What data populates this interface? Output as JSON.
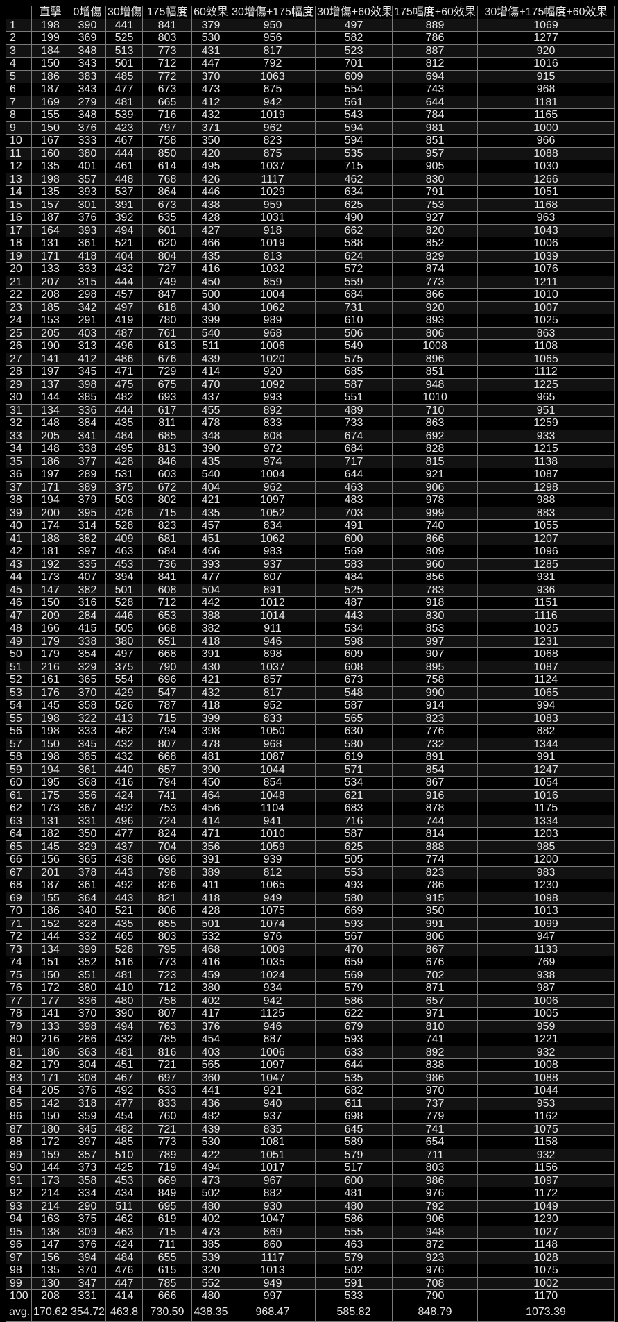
{
  "table": {
    "headers": [
      "",
      "直擊",
      "0增傷",
      "30增傷",
      "175幅度",
      "60效果",
      "30增傷+175幅度",
      "30增傷+60效果",
      "175幅度+60效果",
      "30增傷+175幅度+60效果"
    ],
    "rows": [
      [
        "1",
        "198",
        "390",
        "441",
        "841",
        "379",
        "950",
        "497",
        "889",
        "1069"
      ],
      [
        "2",
        "199",
        "369",
        "525",
        "803",
        "530",
        "956",
        "582",
        "786",
        "1277"
      ],
      [
        "3",
        "184",
        "348",
        "513",
        "773",
        "431",
        "817",
        "523",
        "887",
        "920"
      ],
      [
        "4",
        "150",
        "343",
        "501",
        "712",
        "447",
        "792",
        "701",
        "812",
        "1016"
      ],
      [
        "5",
        "186",
        "383",
        "485",
        "772",
        "370",
        "1063",
        "609",
        "694",
        "915"
      ],
      [
        "6",
        "187",
        "343",
        "477",
        "673",
        "473",
        "875",
        "554",
        "743",
        "968"
      ],
      [
        "7",
        "169",
        "279",
        "481",
        "665",
        "412",
        "942",
        "561",
        "644",
        "1181"
      ],
      [
        "8",
        "155",
        "348",
        "539",
        "716",
        "432",
        "1019",
        "543",
        "784",
        "1165"
      ],
      [
        "9",
        "150",
        "376",
        "423",
        "797",
        "371",
        "962",
        "594",
        "981",
        "1000"
      ],
      [
        "10",
        "167",
        "333",
        "467",
        "758",
        "350",
        "823",
        "594",
        "851",
        "966"
      ],
      [
        "11",
        "160",
        "380",
        "444",
        "850",
        "420",
        "875",
        "535",
        "957",
        "1088"
      ],
      [
        "12",
        "135",
        "401",
        "461",
        "614",
        "495",
        "1037",
        "715",
        "905",
        "1030"
      ],
      [
        "13",
        "198",
        "357",
        "448",
        "768",
        "426",
        "1117",
        "462",
        "830",
        "1266"
      ],
      [
        "14",
        "135",
        "393",
        "537",
        "864",
        "446",
        "1029",
        "634",
        "791",
        "1051"
      ],
      [
        "15",
        "157",
        "301",
        "391",
        "673",
        "438",
        "959",
        "625",
        "753",
        "1168"
      ],
      [
        "16",
        "187",
        "376",
        "392",
        "635",
        "428",
        "1031",
        "490",
        "927",
        "963"
      ],
      [
        "17",
        "164",
        "393",
        "494",
        "601",
        "427",
        "918",
        "662",
        "820",
        "1043"
      ],
      [
        "18",
        "131",
        "361",
        "521",
        "620",
        "466",
        "1019",
        "588",
        "852",
        "1006"
      ],
      [
        "19",
        "171",
        "418",
        "404",
        "804",
        "435",
        "813",
        "624",
        "829",
        "1039"
      ],
      [
        "20",
        "133",
        "333",
        "432",
        "727",
        "416",
        "1032",
        "572",
        "874",
        "1076"
      ],
      [
        "21",
        "207",
        "315",
        "444",
        "749",
        "450",
        "859",
        "559",
        "773",
        "1211"
      ],
      [
        "22",
        "208",
        "298",
        "457",
        "847",
        "500",
        "1004",
        "684",
        "866",
        "1010"
      ],
      [
        "23",
        "185",
        "342",
        "497",
        "618",
        "430",
        "1062",
        "731",
        "920",
        "1007"
      ],
      [
        "24",
        "153",
        "291",
        "419",
        "780",
        "399",
        "989",
        "610",
        "893",
        "1025"
      ],
      [
        "25",
        "205",
        "403",
        "487",
        "761",
        "540",
        "968",
        "506",
        "806",
        "863"
      ],
      [
        "26",
        "190",
        "313",
        "496",
        "613",
        "511",
        "1006",
        "549",
        "1008",
        "1108"
      ],
      [
        "27",
        "141",
        "412",
        "486",
        "676",
        "439",
        "1020",
        "575",
        "896",
        "1065"
      ],
      [
        "28",
        "197",
        "345",
        "471",
        "729",
        "414",
        "920",
        "685",
        "851",
        "1112"
      ],
      [
        "29",
        "137",
        "398",
        "475",
        "675",
        "470",
        "1092",
        "587",
        "948",
        "1225"
      ],
      [
        "30",
        "144",
        "385",
        "482",
        "693",
        "437",
        "993",
        "551",
        "1010",
        "965"
      ],
      [
        "31",
        "134",
        "336",
        "444",
        "617",
        "455",
        "892",
        "489",
        "710",
        "951"
      ],
      [
        "32",
        "148",
        "384",
        "435",
        "811",
        "478",
        "833",
        "733",
        "863",
        "1259"
      ],
      [
        "33",
        "205",
        "341",
        "484",
        "685",
        "348",
        "808",
        "674",
        "692",
        "933"
      ],
      [
        "34",
        "148",
        "338",
        "495",
        "813",
        "390",
        "972",
        "684",
        "828",
        "1215"
      ],
      [
        "35",
        "186",
        "377",
        "428",
        "846",
        "435",
        "974",
        "717",
        "815",
        "1138"
      ],
      [
        "36",
        "197",
        "289",
        "531",
        "603",
        "540",
        "1004",
        "644",
        "921",
        "1087"
      ],
      [
        "37",
        "171",
        "389",
        "375",
        "672",
        "404",
        "962",
        "463",
        "906",
        "1298"
      ],
      [
        "38",
        "194",
        "379",
        "503",
        "802",
        "421",
        "1097",
        "483",
        "978",
        "988"
      ],
      [
        "39",
        "200",
        "395",
        "426",
        "715",
        "435",
        "1052",
        "703",
        "999",
        "883"
      ],
      [
        "40",
        "174",
        "314",
        "528",
        "823",
        "457",
        "834",
        "491",
        "740",
        "1055"
      ],
      [
        "41",
        "188",
        "382",
        "409",
        "681",
        "451",
        "1062",
        "600",
        "866",
        "1207"
      ],
      [
        "42",
        "181",
        "397",
        "463",
        "684",
        "466",
        "983",
        "569",
        "809",
        "1096"
      ],
      [
        "43",
        "192",
        "335",
        "453",
        "736",
        "393",
        "937",
        "583",
        "960",
        "1285"
      ],
      [
        "44",
        "173",
        "407",
        "394",
        "841",
        "477",
        "807",
        "484",
        "856",
        "931"
      ],
      [
        "45",
        "147",
        "382",
        "501",
        "608",
        "504",
        "891",
        "525",
        "783",
        "936"
      ],
      [
        "46",
        "150",
        "316",
        "528",
        "712",
        "442",
        "1012",
        "487",
        "918",
        "1151"
      ],
      [
        "47",
        "209",
        "284",
        "446",
        "653",
        "388",
        "1014",
        "443",
        "830",
        "1116"
      ],
      [
        "48",
        "166",
        "415",
        "505",
        "668",
        "382",
        "911",
        "534",
        "853",
        "1025"
      ],
      [
        "49",
        "179",
        "338",
        "380",
        "651",
        "418",
        "946",
        "598",
        "997",
        "1231"
      ],
      [
        "50",
        "179",
        "354",
        "497",
        "668",
        "391",
        "898",
        "609",
        "907",
        "1068"
      ],
      [
        "51",
        "216",
        "329",
        "375",
        "790",
        "430",
        "1037",
        "608",
        "895",
        "1087"
      ],
      [
        "52",
        "161",
        "365",
        "554",
        "696",
        "421",
        "857",
        "673",
        "758",
        "1124"
      ],
      [
        "53",
        "176",
        "370",
        "429",
        "547",
        "432",
        "817",
        "548",
        "990",
        "1065"
      ],
      [
        "54",
        "145",
        "358",
        "526",
        "787",
        "418",
        "952",
        "587",
        "914",
        "994"
      ],
      [
        "55",
        "198",
        "322",
        "413",
        "715",
        "399",
        "833",
        "565",
        "823",
        "1083"
      ],
      [
        "56",
        "198",
        "333",
        "462",
        "794",
        "398",
        "1050",
        "630",
        "776",
        "882"
      ],
      [
        "57",
        "150",
        "345",
        "432",
        "807",
        "478",
        "968",
        "580",
        "732",
        "1344"
      ],
      [
        "58",
        "198",
        "385",
        "432",
        "668",
        "481",
        "1087",
        "619",
        "891",
        "991"
      ],
      [
        "59",
        "194",
        "361",
        "440",
        "657",
        "390",
        "1044",
        "571",
        "854",
        "1247"
      ],
      [
        "60",
        "195",
        "368",
        "416",
        "794",
        "450",
        "854",
        "534",
        "867",
        "1054"
      ],
      [
        "61",
        "175",
        "356",
        "424",
        "741",
        "464",
        "1048",
        "621",
        "916",
        "1016"
      ],
      [
        "62",
        "173",
        "367",
        "492",
        "753",
        "456",
        "1104",
        "683",
        "878",
        "1175"
      ],
      [
        "63",
        "131",
        "331",
        "496",
        "724",
        "414",
        "941",
        "716",
        "744",
        "1334"
      ],
      [
        "64",
        "182",
        "350",
        "477",
        "824",
        "471",
        "1010",
        "587",
        "814",
        "1203"
      ],
      [
        "65",
        "145",
        "329",
        "437",
        "704",
        "356",
        "1059",
        "625",
        "888",
        "985"
      ],
      [
        "66",
        "156",
        "365",
        "438",
        "696",
        "391",
        "939",
        "505",
        "774",
        "1200"
      ],
      [
        "67",
        "201",
        "378",
        "443",
        "798",
        "389",
        "812",
        "553",
        "823",
        "983"
      ],
      [
        "68",
        "187",
        "361",
        "492",
        "826",
        "411",
        "1065",
        "493",
        "786",
        "1230"
      ],
      [
        "69",
        "155",
        "364",
        "443",
        "821",
        "418",
        "949",
        "580",
        "915",
        "1098"
      ],
      [
        "70",
        "186",
        "340",
        "521",
        "806",
        "428",
        "1075",
        "669",
        "950",
        "1013"
      ],
      [
        "71",
        "152",
        "328",
        "435",
        "655",
        "501",
        "1074",
        "593",
        "991",
        "1099"
      ],
      [
        "72",
        "144",
        "332",
        "465",
        "803",
        "532",
        "976",
        "567",
        "806",
        "947"
      ],
      [
        "73",
        "134",
        "399",
        "528",
        "795",
        "468",
        "1009",
        "470",
        "867",
        "1133"
      ],
      [
        "74",
        "151",
        "352",
        "516",
        "773",
        "416",
        "1035",
        "659",
        "676",
        "769"
      ],
      [
        "75",
        "150",
        "351",
        "481",
        "723",
        "459",
        "1024",
        "569",
        "702",
        "938"
      ],
      [
        "76",
        "172",
        "380",
        "410",
        "712",
        "380",
        "934",
        "579",
        "871",
        "987"
      ],
      [
        "77",
        "177",
        "336",
        "480",
        "758",
        "402",
        "942",
        "586",
        "657",
        "1006"
      ],
      [
        "78",
        "141",
        "370",
        "390",
        "807",
        "417",
        "1125",
        "622",
        "971",
        "1005"
      ],
      [
        "79",
        "133",
        "398",
        "494",
        "763",
        "376",
        "946",
        "679",
        "810",
        "959"
      ],
      [
        "80",
        "216",
        "286",
        "432",
        "785",
        "454",
        "887",
        "593",
        "741",
        "1221"
      ],
      [
        "81",
        "186",
        "363",
        "481",
        "816",
        "403",
        "1006",
        "633",
        "892",
        "932"
      ],
      [
        "82",
        "179",
        "304",
        "451",
        "721",
        "565",
        "1097",
        "644",
        "838",
        "1008"
      ],
      [
        "83",
        "171",
        "308",
        "467",
        "697",
        "360",
        "1047",
        "535",
        "986",
        "1088"
      ],
      [
        "84",
        "205",
        "376",
        "492",
        "633",
        "441",
        "921",
        "682",
        "970",
        "1044"
      ],
      [
        "85",
        "142",
        "318",
        "477",
        "833",
        "436",
        "940",
        "611",
        "737",
        "953"
      ],
      [
        "86",
        "150",
        "359",
        "454",
        "760",
        "482",
        "937",
        "698",
        "779",
        "1162"
      ],
      [
        "87",
        "180",
        "345",
        "482",
        "721",
        "439",
        "835",
        "645",
        "741",
        "1075"
      ],
      [
        "88",
        "172",
        "397",
        "485",
        "773",
        "530",
        "1081",
        "589",
        "654",
        "1158"
      ],
      [
        "89",
        "159",
        "357",
        "510",
        "789",
        "422",
        "1051",
        "579",
        "711",
        "932"
      ],
      [
        "90",
        "144",
        "373",
        "425",
        "719",
        "494",
        "1017",
        "517",
        "803",
        "1156"
      ],
      [
        "91",
        "173",
        "358",
        "453",
        "669",
        "473",
        "967",
        "600",
        "986",
        "1097"
      ],
      [
        "92",
        "214",
        "334",
        "434",
        "849",
        "502",
        "882",
        "481",
        "976",
        "1172"
      ],
      [
        "93",
        "214",
        "290",
        "511",
        "695",
        "480",
        "930",
        "480",
        "792",
        "1049"
      ],
      [
        "94",
        "163",
        "375",
        "462",
        "619",
        "402",
        "1047",
        "586",
        "906",
        "1230"
      ],
      [
        "95",
        "138",
        "309",
        "463",
        "715",
        "473",
        "869",
        "555",
        "948",
        "1027"
      ],
      [
        "96",
        "147",
        "376",
        "424",
        "711",
        "385",
        "860",
        "463",
        "872",
        "1148"
      ],
      [
        "97",
        "156",
        "394",
        "484",
        "655",
        "539",
        "1117",
        "579",
        "923",
        "1028"
      ],
      [
        "98",
        "135",
        "370",
        "476",
        "615",
        "320",
        "1013",
        "502",
        "976",
        "1075"
      ],
      [
        "99",
        "130",
        "347",
        "447",
        "785",
        "552",
        "949",
        "591",
        "708",
        "1002"
      ],
      [
        "100",
        "208",
        "331",
        "414",
        "666",
        "480",
        "997",
        "533",
        "790",
        "1170"
      ]
    ],
    "footer": [
      "avg.",
      "170.62",
      "354.72",
      "463.8",
      "730.59",
      "438.35",
      "968.47",
      "585.82",
      "848.79",
      "1073.39"
    ]
  }
}
